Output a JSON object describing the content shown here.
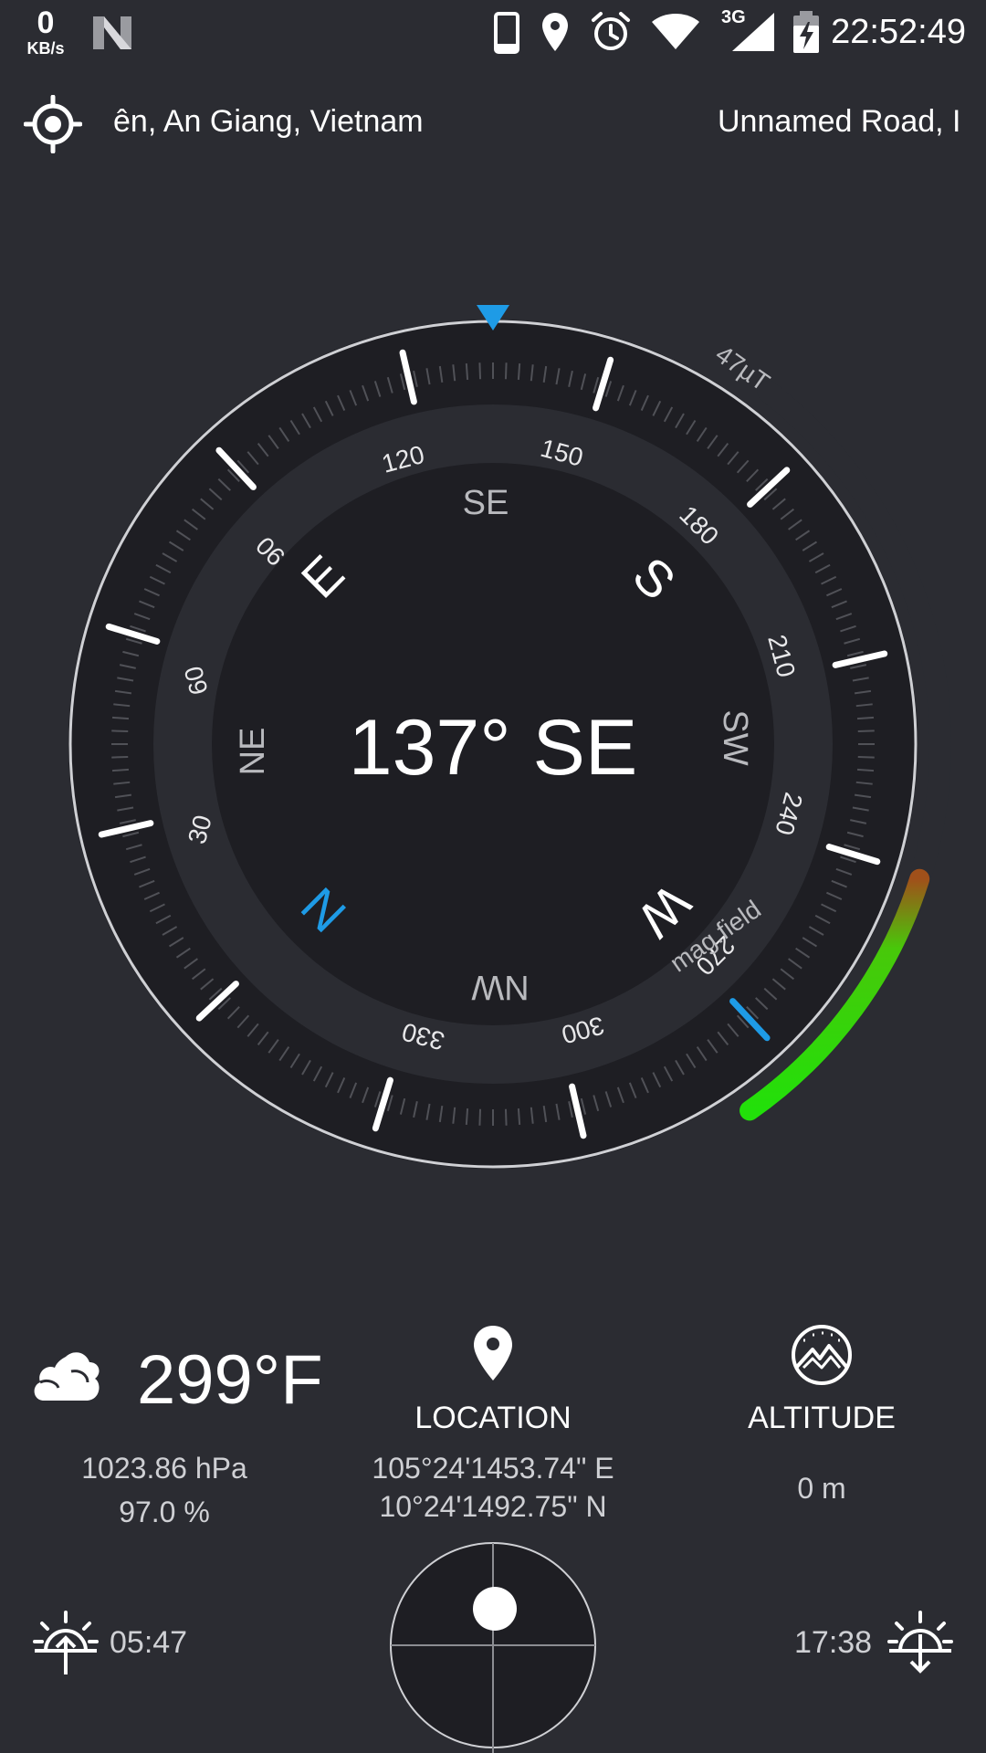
{
  "status_bar": {
    "net_speed_value": "0",
    "net_speed_unit": "KB/s",
    "network_type": "3G",
    "time": "22:52:49",
    "icons": [
      "n-logo-icon",
      "phone-icon",
      "location-pin-icon",
      "alarm-icon",
      "wifi-icon",
      "signal-icon",
      "battery-charging-icon"
    ]
  },
  "address": {
    "left_text": "ên, An Giang, Vietnam",
    "right_text": "Unnamed Road, I"
  },
  "compass": {
    "heading_text": "137° SE",
    "degree_labels": [
      "30",
      "60",
      "90",
      "120",
      "150",
      "180",
      "210",
      "240",
      "270",
      "300",
      "330"
    ],
    "cardinals": {
      "n": "N",
      "e": "E",
      "s": "S",
      "w": "W"
    },
    "intercardinals": {
      "ne": "NE",
      "se": "SE",
      "sw": "SW",
      "nw": "NW"
    },
    "mag_field_value": "47µT",
    "mag_field_label": "mag.field",
    "mag_field_level": 0.35,
    "accent_color": "#1e9be6",
    "mag_color": "#22e00a"
  },
  "weather": {
    "temperature": "299°F",
    "pressure": "1023.86 hPa",
    "humidity": "97.0 %",
    "icon": "cloud-icon"
  },
  "location": {
    "title": "LOCATION",
    "longitude": "105°24'1453.74\" E",
    "latitude": "10°24'1492.75\" N",
    "icon": "location-pin-icon"
  },
  "altitude": {
    "title": "ALTITUDE",
    "value": "0 m",
    "icon": "mountain-icon"
  },
  "sun": {
    "sunrise": "05:47",
    "sunset": "17:38"
  }
}
